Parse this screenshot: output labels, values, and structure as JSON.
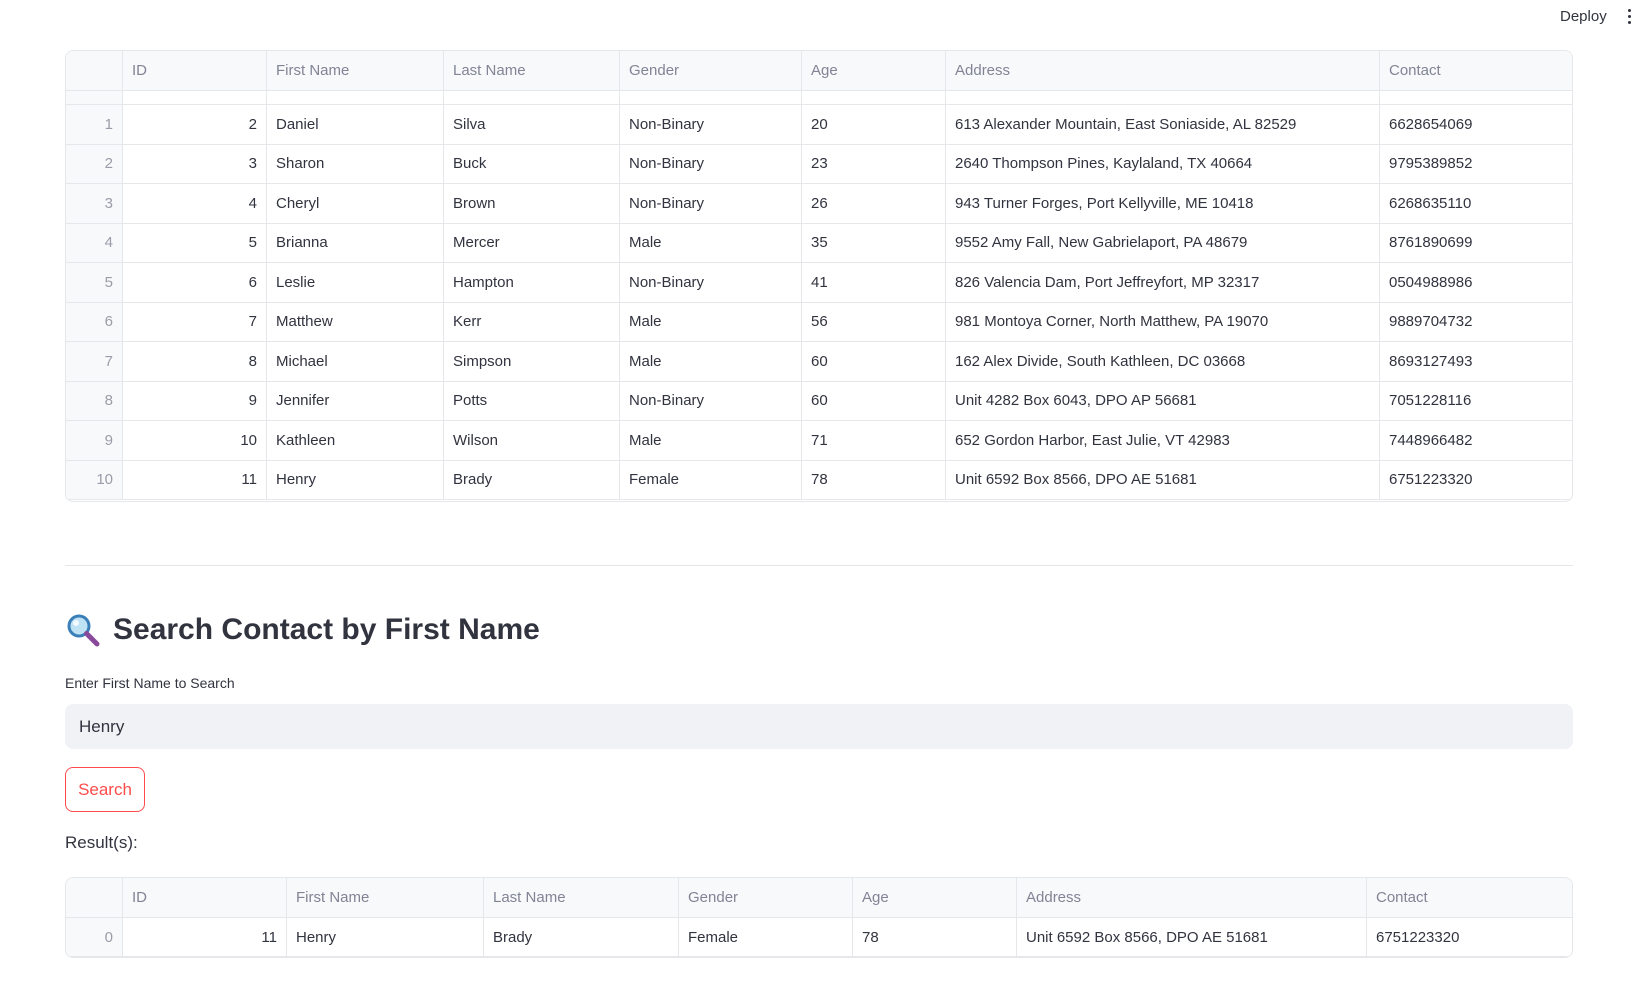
{
  "header": {
    "deploy_label": "Deploy"
  },
  "main_table": {
    "columns": [
      "",
      "ID",
      "First Name",
      "Last Name",
      "Gender",
      "Age",
      "Address",
      "Contact"
    ],
    "rows": [
      [
        "1",
        "2",
        "Daniel",
        "Silva",
        "Non-Binary",
        "20",
        "613 Alexander Mountain, East Soniaside, AL 82529",
        "6628654069"
      ],
      [
        "2",
        "3",
        "Sharon",
        "Buck",
        "Non-Binary",
        "23",
        "2640 Thompson Pines, Kaylaland, TX 40664",
        "9795389852"
      ],
      [
        "3",
        "4",
        "Cheryl",
        "Brown",
        "Non-Binary",
        "26",
        "943 Turner Forges, Port Kellyville, ME 10418",
        "6268635110"
      ],
      [
        "4",
        "5",
        "Brianna",
        "Mercer",
        "Male",
        "35",
        "9552 Amy Fall, New Gabrielaport, PA 48679",
        "8761890699"
      ],
      [
        "5",
        "6",
        "Leslie",
        "Hampton",
        "Non-Binary",
        "41",
        "826 Valencia Dam, Port Jeffreyfort, MP 32317",
        "0504988986"
      ],
      [
        "6",
        "7",
        "Matthew",
        "Kerr",
        "Male",
        "56",
        "981 Montoya Corner, North Matthew, PA 19070",
        "9889704732"
      ],
      [
        "7",
        "8",
        "Michael",
        "Simpson",
        "Male",
        "60",
        "162 Alex Divide, South Kathleen, DC 03668",
        "8693127493"
      ],
      [
        "8",
        "9",
        "Jennifer",
        "Potts",
        "Non-Binary",
        "60",
        "Unit 4282 Box 6043, DPO AP 56681",
        "7051228116"
      ],
      [
        "9",
        "10",
        "Kathleen",
        "Wilson",
        "Male",
        "71",
        "652 Gordon Harbor, East Julie, VT 42983",
        "7448966482"
      ],
      [
        "10",
        "11",
        "Henry",
        "Brady",
        "Female",
        "78",
        "Unit 6592 Box 8566, DPO AE 51681",
        "6751223320"
      ]
    ]
  },
  "search": {
    "title": "Search Contact by First Name",
    "title_icon": "magnifying-glass-icon",
    "input_label": "Enter First Name to Search",
    "input_value": "Henry",
    "button_label": "Search",
    "results_label": "Result(s):"
  },
  "result_table": {
    "columns": [
      "",
      "ID",
      "First Name",
      "Last Name",
      "Gender",
      "Age",
      "Address",
      "Contact"
    ],
    "rows": [
      [
        "0",
        "11",
        "Henry",
        "Brady",
        "Female",
        "78",
        "Unit 6592 Box 8566, DPO AE 51681",
        "6751223320"
      ]
    ]
  },
  "colors": {
    "accent": "#ff4b4b",
    "input_bg": "#f0f2f6",
    "border": "#e6e7ea"
  }
}
